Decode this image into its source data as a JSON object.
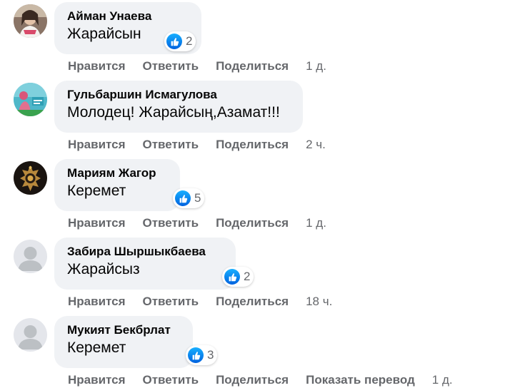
{
  "colors": {
    "bubble_bg": "#f0f2f5",
    "secondary_text": "#65676b",
    "primary_text": "#050505",
    "like_blue": "#1877f2"
  },
  "comments": [
    {
      "author": "Айман Унаева",
      "text": "Жарайсын",
      "reaction_icon": "like-icon",
      "reaction_count": "2",
      "actions": {
        "like": "Нравится",
        "reply": "Ответить",
        "share": "Поделиться"
      },
      "time": "1 д."
    },
    {
      "author": "Гульбаршин Исмагулова",
      "text": "Молодец! Жарайсың,Азамат!!!",
      "actions": {
        "like": "Нравится",
        "reply": "Ответить",
        "share": "Поделиться"
      },
      "time": "2 ч."
    },
    {
      "author": "Мариям Жагор",
      "text": "Керемет",
      "reaction_icon": "like-icon",
      "reaction_count": "5",
      "actions": {
        "like": "Нравится",
        "reply": "Ответить",
        "share": "Поделиться"
      },
      "time": "1 д."
    },
    {
      "author": "Забира Шыршыкбаева",
      "text": "Жарайсыз",
      "reaction_icon": "like-icon",
      "reaction_count": "2",
      "actions": {
        "like": "Нравится",
        "reply": "Ответить",
        "share": "Поделиться"
      },
      "time": "18 ч."
    },
    {
      "author": "Мукият Бекбрлат",
      "text": "Керемет",
      "reaction_icon": "like-icon",
      "reaction_count": "3",
      "actions": {
        "like": "Нравится",
        "reply": "Ответить",
        "share": "Поделиться",
        "translate": "Показать перевод"
      },
      "time": "1 д."
    }
  ]
}
